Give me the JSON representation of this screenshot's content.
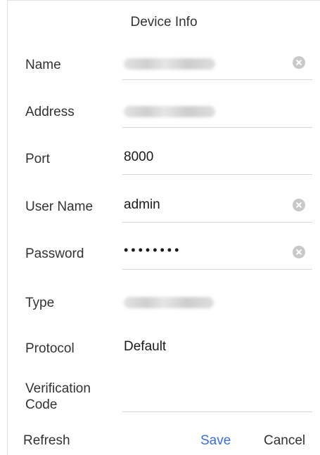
{
  "dialog": {
    "title": "Device Info"
  },
  "fields": {
    "name": {
      "label": "Name",
      "value": ""
    },
    "address": {
      "label": "Address",
      "value": ""
    },
    "port": {
      "label": "Port",
      "value": "8000"
    },
    "user_name": {
      "label": "User Name",
      "value": "admin"
    },
    "password": {
      "label": "Password",
      "value": "••••••••"
    },
    "type": {
      "label": "Type",
      "value": ""
    },
    "protocol": {
      "label": "Protocol",
      "value": "Default"
    },
    "verification_code": {
      "label_line1": "Verification",
      "label_line2": "Code",
      "value": ""
    }
  },
  "footer": {
    "refresh_label": "Refresh",
    "save_label": "Save",
    "cancel_label": "Cancel"
  },
  "colors": {
    "accent": "#3b6fd6",
    "text": "#333333",
    "divider": "#d6d6d6",
    "clear_icon": "#c9c9c9"
  },
  "icons": {
    "clear": "clear-circle-x-icon"
  }
}
